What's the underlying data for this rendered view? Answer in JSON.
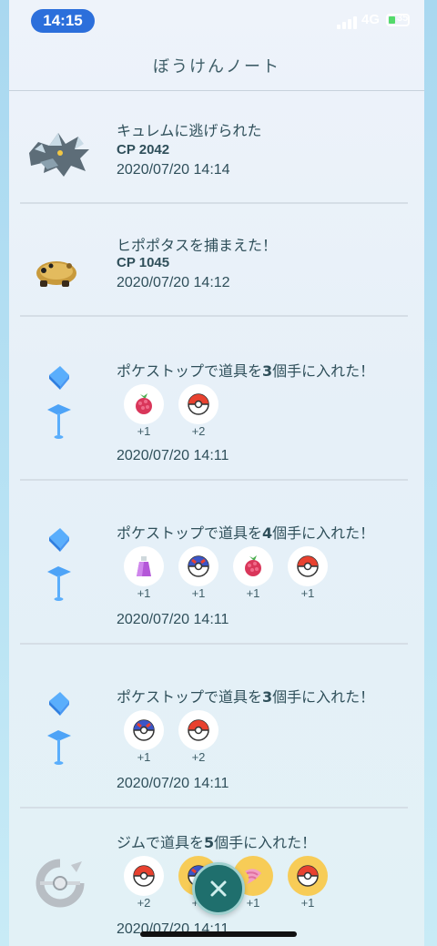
{
  "status_bar": {
    "time": "14:15",
    "network": "4G",
    "battery_text": "35"
  },
  "header": {
    "title": "ぼうけんノート"
  },
  "entries": [
    {
      "title": "キュレムに逃げられた",
      "cp": "CP 2042",
      "date": "2020/07/20 14:14",
      "icon": "kyurem-icon"
    },
    {
      "title": "ヒポポタスを捕まえた！",
      "cp": "CP 1045",
      "date": "2020/07/20 14:12",
      "icon": "hippopotas-icon"
    },
    {
      "title_pre": "ポケストップで道具を",
      "count": "3",
      "title_post": "個手に入れた！",
      "date": "2020/07/20 14:11",
      "items": [
        {
          "icon": "razz-berry-icon",
          "qty": "+1"
        },
        {
          "icon": "poke-ball-icon",
          "qty": "+2"
        }
      ]
    },
    {
      "title_pre": "ポケストップで道具を",
      "count": "4",
      "title_post": "個手に入れた！",
      "date": "2020/07/20 14:11",
      "items": [
        {
          "icon": "potion-icon",
          "qty": "+1"
        },
        {
          "icon": "great-ball-icon",
          "qty": "+1"
        },
        {
          "icon": "razz-berry-icon",
          "qty": "+1"
        },
        {
          "icon": "poke-ball-icon",
          "qty": "+1"
        }
      ]
    },
    {
      "title_pre": "ポケストップで道具を",
      "count": "3",
      "title_post": "個手に入れた！",
      "date": "2020/07/20 14:11",
      "items": [
        {
          "icon": "great-ball-icon",
          "qty": "+1"
        },
        {
          "icon": "poke-ball-icon",
          "qty": "+2"
        }
      ]
    },
    {
      "title_pre": "ジムで道具を",
      "count": "5",
      "title_post": "個手に入れた！",
      "date": "2020/07/20 14:11",
      "items": [
        {
          "icon": "poke-ball-icon",
          "qty": "+2"
        },
        {
          "icon": "great-ball-icon",
          "qty": "+1"
        },
        {
          "icon": "nanab-berry-icon",
          "qty": "+1"
        },
        {
          "icon": "poke-ball-icon",
          "qty": "+1"
        }
      ]
    }
  ],
  "colors": {
    "poke_ball_red": "#e8412f",
    "great_ball_blue": "#3b55c8",
    "berry_pink": "#d9365a",
    "potion_purple": "#b457d8",
    "gym_gold": "#f7cc57",
    "close_button": "#1f6f6d"
  }
}
